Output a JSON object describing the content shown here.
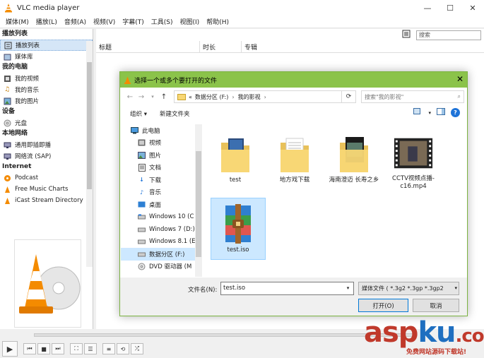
{
  "window": {
    "title": "VLC media player"
  },
  "menu": [
    "媒体(M)",
    "播放(L)",
    "音频(A)",
    "视频(V)",
    "字幕(T)",
    "工具(S)",
    "视图(I)",
    "帮助(H)"
  ],
  "sidebar": {
    "sections": [
      {
        "title": "播放列表",
        "items": [
          {
            "label": "播放列表",
            "icon": "playlist-icon",
            "selected": true
          },
          {
            "label": "媒体库",
            "icon": "media-library-icon"
          }
        ]
      },
      {
        "title": "我的电脑",
        "items": [
          {
            "label": "我的视频",
            "icon": "video-icon"
          },
          {
            "label": "我的音乐",
            "icon": "music-icon"
          },
          {
            "label": "我的图片",
            "icon": "picture-icon"
          }
        ]
      },
      {
        "title": "设备",
        "items": [
          {
            "label": "光盘",
            "icon": "disc-icon"
          }
        ]
      },
      {
        "title": "本地网络",
        "items": [
          {
            "label": "通用即插即播",
            "icon": "upnp-icon"
          },
          {
            "label": "网络流 (SAP)",
            "icon": "network-stream-icon"
          }
        ]
      },
      {
        "title": "Internet",
        "items": [
          {
            "label": "Podcast",
            "icon": "podcast-icon"
          },
          {
            "label": "Free Music Charts",
            "icon": "music-charts-icon"
          },
          {
            "label": "iCast Stream Directory",
            "icon": "icast-icon"
          }
        ]
      }
    ]
  },
  "playlist": {
    "search_placeholder": "搜索",
    "columns": [
      "标题",
      "时长",
      "专辑"
    ]
  },
  "dialog": {
    "title": "选择一个或多个要打开的文件",
    "address": {
      "prefix": "«",
      "parts": [
        "数据分区 (F:)",
        "我的影视"
      ]
    },
    "search_placeholder": "搜索\"我的影视\"",
    "organize": "组织 ▾",
    "new_folder": "新建文件夹",
    "tree": [
      {
        "label": "此电脑",
        "icon": "computer-icon",
        "level": 0
      },
      {
        "label": "视频",
        "icon": "video-folder-icon",
        "level": 1
      },
      {
        "label": "图片",
        "icon": "pictures-folder-icon",
        "level": 1
      },
      {
        "label": "文档",
        "icon": "documents-folder-icon",
        "level": 1
      },
      {
        "label": "下载",
        "icon": "downloads-folder-icon",
        "level": 1
      },
      {
        "label": "音乐",
        "icon": "music-folder-icon",
        "level": 1
      },
      {
        "label": "桌面",
        "icon": "desktop-folder-icon",
        "level": 1
      },
      {
        "label": "Windows 10 (C",
        "icon": "drive-icon",
        "level": 1
      },
      {
        "label": "Windows 7 (D:)",
        "icon": "drive-icon",
        "level": 1
      },
      {
        "label": "Windows 8.1 (E",
        "icon": "drive-icon",
        "level": 1
      },
      {
        "label": "数据分区 (F:)",
        "icon": "drive-icon",
        "level": 1,
        "selected": true
      },
      {
        "label": "DVD 驱动器 (M",
        "icon": "dvd-drive-icon",
        "level": 1
      }
    ],
    "files": [
      {
        "label": "test",
        "kind": "folder-blue"
      },
      {
        "label": "地方戏下载",
        "kind": "folder-docs"
      },
      {
        "label": "海南澄迈 长寿之乡",
        "kind": "folder-dark"
      },
      {
        "label": "CCTV视频点播-c16.mp4",
        "kind": "video"
      },
      {
        "label": "test.iso",
        "kind": "iso",
        "selected": true
      }
    ],
    "filename_label": "文件名(N):",
    "filename_value": "test.iso",
    "filetype": "媒体文件 ( *.3g2 *.3gp *.3gp2",
    "open_button": "打开(O)",
    "cancel_button": "取消"
  },
  "watermark": {
    "text_a": "asp",
    "text_b": "ku",
    "text_c": ".com",
    "sub": "免费网站源码下载站!"
  },
  "colors": {
    "dialog_title": "#8bc34a",
    "vlc_orange": "#f48b00",
    "selection": "#cce8ff"
  }
}
